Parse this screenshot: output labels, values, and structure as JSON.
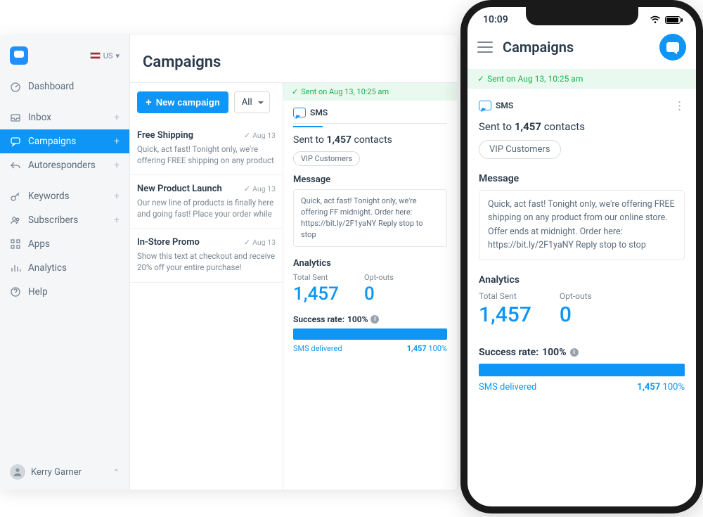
{
  "locale": {
    "code": "US"
  },
  "sidebar": {
    "items": [
      {
        "label": "Dashboard"
      },
      {
        "label": "Inbox"
      },
      {
        "label": "Campaigns"
      },
      {
        "label": "Autoresponders"
      },
      {
        "label": "Keywords"
      },
      {
        "label": "Subscribers"
      },
      {
        "label": "Apps"
      },
      {
        "label": "Analytics"
      },
      {
        "label": "Help"
      }
    ]
  },
  "user": {
    "name": "Kerry Garner"
  },
  "page": {
    "title": "Campaigns"
  },
  "toolbar": {
    "new_label": "New campaign",
    "filter_label": "All"
  },
  "campaigns": [
    {
      "title": "Free Shipping",
      "date": "Aug 13",
      "desc": "Quick, act fast! Tonight only, we're offering FREE shipping on any product"
    },
    {
      "title": "New Product Launch",
      "date": "Aug 13",
      "desc": "Our new line of products is finally here and going fast! Place your order while"
    },
    {
      "title": "In-Store Promo",
      "date": "Aug 13",
      "desc": "Show this text at checkout and receive 20% off your entire purchase!"
    }
  ],
  "detail": {
    "sent_banner": "Sent on Aug 13, 10:25 am",
    "tab_label": "SMS",
    "sent_to_prefix": "Sent to",
    "sent_to_count": "1,457",
    "sent_to_suffix": "contacts",
    "segment_chip": "VIP Customers",
    "message_title": "Message",
    "message_text_truncated": "Quick, act fast! Tonight only, we're offering FF midnight. Order here: https://bit.ly/2F1yaNY Reply stop to stop",
    "message_text_full": "Quick, act fast! Tonight only, we're offering FREE shipping on any product from our online store. Offer ends at midnight. Order here: https://bit.ly/2F1yaNY\nReply stop to stop",
    "analytics_title": "Analytics",
    "total_sent_label": "Total Sent",
    "total_sent_value": "1,457",
    "optouts_label": "Opt-outs",
    "optouts_value": "0",
    "success_label": "Success rate:",
    "success_value": "100%",
    "delivered_label": "SMS delivered",
    "delivered_count": "1,457",
    "delivered_pct": "100%"
  },
  "phone": {
    "time": "10:09",
    "title": "Campaigns"
  }
}
